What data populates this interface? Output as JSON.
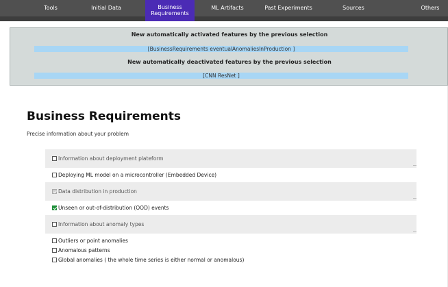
{
  "nav": {
    "items": [
      {
        "label": "Tools"
      },
      {
        "label": "Initial Data"
      },
      {
        "label": "Business Requirements"
      },
      {
        "label": "ML Artifacts"
      },
      {
        "label": "Past Experiments"
      },
      {
        "label": "Sources"
      },
      {
        "label": "Others"
      }
    ],
    "active_index": 2
  },
  "notice": {
    "activated_heading": "New automatically activated features by the previous selection",
    "activated_list": "[BusinessRequirements eventualAnomaliesInProduction ]",
    "deactivated_heading": "New automatically deactivated features by the previous selection",
    "deactivated_list": "[CNN ResNet ]"
  },
  "page": {
    "title": "Business Requirements",
    "subtitle": "Precise information about your problem"
  },
  "form": {
    "deployment_section": "Information about deployment plateform",
    "microcontroller_option": "Deploying ML model on a microcontroller (Embedded Device)",
    "distribution_section": "Data distribution in production",
    "ood_option": "Unseen or out-of-distribution (OOD) events",
    "anomaly_section": "Information about anomaly types",
    "outliers_option": "Outliers or point anomalies",
    "patterns_option": "Anomalous patterns",
    "global_option": "Global anomalies ( the whole time series is either normal or anomalous)"
  },
  "colors": {
    "nav_active": "#4b2bb5",
    "nav_bg": "#505050",
    "notice_bg": "#d4dad9",
    "notice_bar": "#a8d6f5",
    "checked": "#1f8f3a"
  }
}
